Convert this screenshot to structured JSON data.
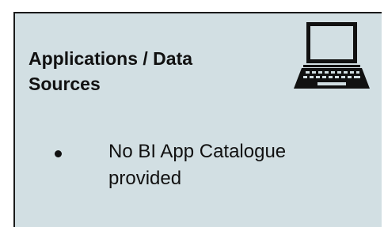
{
  "card": {
    "title": "Applications / Data Sources",
    "icon": "laptop-icon",
    "background": "#d2dfe3",
    "items": [
      {
        "text": "No BI App Catalogue provided"
      }
    ]
  }
}
